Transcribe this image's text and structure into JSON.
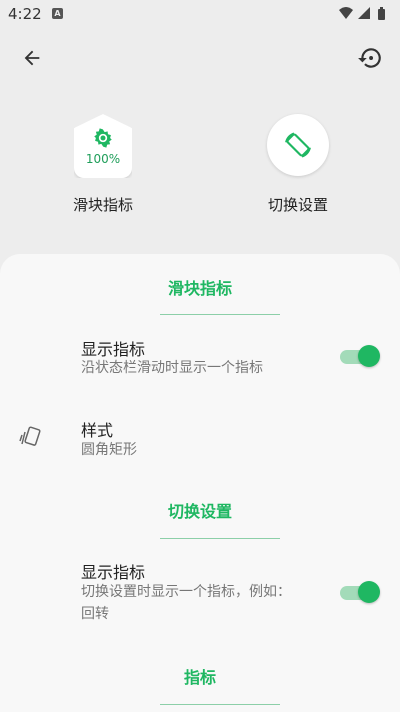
{
  "status_bar": {
    "time": "4:22",
    "notification_letter": "A"
  },
  "choosers": [
    {
      "label": "滑块指标",
      "percent": "100%"
    },
    {
      "label": "切换设置"
    }
  ],
  "sections": {
    "slider": {
      "title": "滑块指标",
      "show_indicator": {
        "title": "显示指标",
        "subtitle": "沿状态栏滑动时显示一个指标",
        "enabled": true
      },
      "style": {
        "title": "样式",
        "subtitle": "圆角矩形"
      }
    },
    "toggle": {
      "title": "切换设置",
      "show_indicator": {
        "title": "显示指标",
        "subtitle": "切换设置时显示一个指标，例如：回转",
        "enabled": true
      }
    },
    "indicator": {
      "title": "指标"
    }
  },
  "colors": {
    "accent": "#1fb762",
    "background": "#ededed",
    "sheet": "#f8f8f8"
  },
  "icons": [
    "back-arrow-icon",
    "history-icon",
    "gear-icon",
    "rotate-icon",
    "cards-icon",
    "wifi-icon",
    "signal-icon",
    "battery-icon"
  ]
}
